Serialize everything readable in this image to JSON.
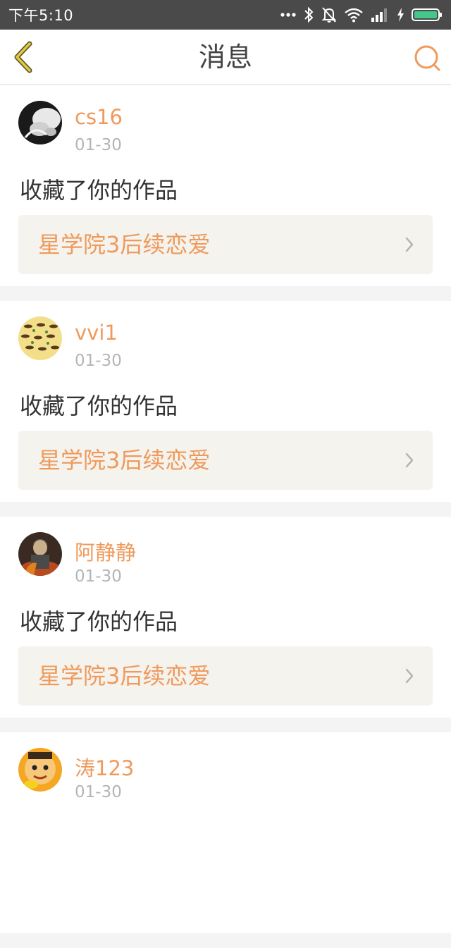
{
  "status_bar": {
    "time": "下午5:10",
    "icons": [
      "more-dots-icon",
      "bluetooth-icon",
      "bell-muted-icon",
      "wifi-icon",
      "signal-icon",
      "charging-icon",
      "battery-icon"
    ]
  },
  "header": {
    "title": "消息",
    "back_icon": "chevron-left-icon",
    "search_icon": "search-icon"
  },
  "colors": {
    "accent": "#ef9a5c",
    "back_accent": "#e8c840",
    "battery": "#46c78a"
  },
  "messages": [
    {
      "user": "cs16",
      "date": "01-30",
      "text": "收藏了你的作品",
      "work_title": "星学院3后续恋爱"
    },
    {
      "user": "vvi1",
      "date": "01-30",
      "text": "收藏了你的作品",
      "work_title": "星学院3后续恋爱"
    },
    {
      "user": "阿静静",
      "date": "01-30",
      "text": "收藏了你的作品",
      "work_title": "星学院3后续恋爱"
    },
    {
      "user": "涛123",
      "date": "01-30"
    }
  ]
}
